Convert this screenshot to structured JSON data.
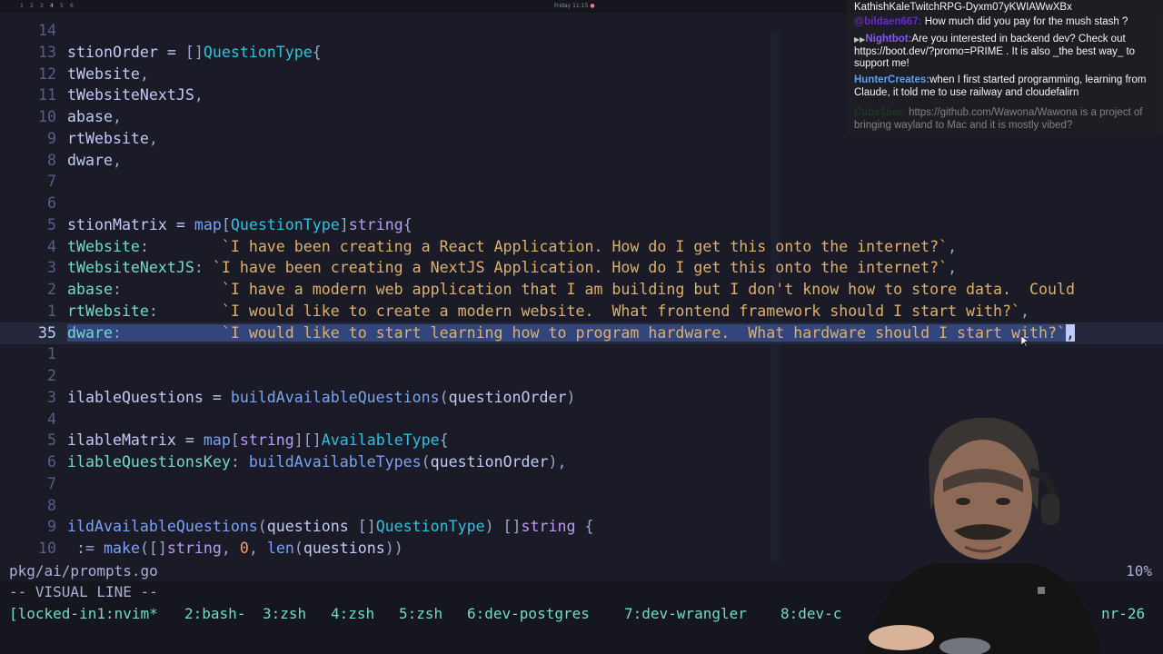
{
  "topbar": {
    "workspaces": [
      "1",
      "2",
      "3",
      "4",
      "5",
      "6"
    ],
    "active_workspace": "4",
    "clock": "Friday 11:15",
    "clock_indicator": "●"
  },
  "editor": {
    "lines": [
      {
        "ln": "14",
        "tokens": []
      },
      {
        "ln": "13",
        "tokens": [
          [
            "t-ident",
            "stionOrder = "
          ],
          [
            "t-punc",
            "[]"
          ],
          [
            "t-type",
            "QuestionType"
          ],
          [
            "t-punc",
            "{"
          ]
        ]
      },
      {
        "ln": "12",
        "tokens": [
          [
            "t-ident",
            "tWebsite"
          ],
          [
            "t-punc",
            ","
          ]
        ]
      },
      {
        "ln": "11",
        "tokens": [
          [
            "t-ident",
            "tWebsiteNextJS"
          ],
          [
            "t-punc",
            ","
          ]
        ]
      },
      {
        "ln": "10",
        "tokens": [
          [
            "t-ident",
            "abase"
          ],
          [
            "t-punc",
            ","
          ]
        ]
      },
      {
        "ln": "9",
        "tokens": [
          [
            "t-ident",
            "rtWebsite"
          ],
          [
            "t-punc",
            ","
          ]
        ]
      },
      {
        "ln": "8",
        "tokens": [
          [
            "t-ident",
            "dware"
          ],
          [
            "t-punc",
            ","
          ]
        ]
      },
      {
        "ln": "7",
        "tokens": []
      },
      {
        "ln": "6",
        "tokens": []
      },
      {
        "ln": "5",
        "tokens": [
          [
            "t-ident",
            "stionMatrix = "
          ],
          [
            "t-call",
            "map"
          ],
          [
            "t-punc",
            "["
          ],
          [
            "t-type",
            "QuestionType"
          ],
          [
            "t-punc",
            "]"
          ],
          [
            "t-kw",
            "string"
          ],
          [
            "t-punc",
            "{"
          ]
        ]
      },
      {
        "ln": "4",
        "tokens": [
          [
            "t-field",
            "tWebsite"
          ],
          [
            "t-punc",
            ":        "
          ],
          [
            "t-str",
            "`I have been creating a React Application. How do I get this onto the internet?`"
          ],
          [
            "t-punc",
            ","
          ]
        ]
      },
      {
        "ln": "3",
        "tokens": [
          [
            "t-field",
            "tWebsiteNextJS"
          ],
          [
            "t-punc",
            ": "
          ],
          [
            "t-str",
            "`I have been creating a NextJS Application. How do I get this onto the internet?`"
          ],
          [
            "t-punc",
            ","
          ]
        ]
      },
      {
        "ln": "2",
        "tokens": [
          [
            "t-field",
            "abase"
          ],
          [
            "t-punc",
            ":           "
          ],
          [
            "t-str",
            "`I have a modern web application that I am building but I don't know how to store data.  Could"
          ]
        ]
      },
      {
        "ln": "1",
        "tokens": [
          [
            "t-field",
            "rtWebsite"
          ],
          [
            "t-punc",
            ":       "
          ],
          [
            "t-str",
            "`I would like to create a modern website.  What frontend framework should I start with?`"
          ],
          [
            "t-punc",
            ","
          ]
        ]
      },
      {
        "ln": "35",
        "current": true,
        "tokens": [
          [
            "t-field hl",
            "dware"
          ],
          [
            "t-punc hl",
            ":           "
          ],
          [
            "t-str hl",
            "`I would like to start learning how to program hardware.  What hardware should I start with?`"
          ],
          [
            "cursor-block",
            ","
          ]
        ]
      },
      {
        "ln": "1",
        "tokens": []
      },
      {
        "ln": "2",
        "tokens": []
      },
      {
        "ln": "3",
        "tokens": [
          [
            "t-ident",
            "ilableQuestions = "
          ],
          [
            "t-call",
            "buildAvailableQuestions"
          ],
          [
            "t-punc",
            "("
          ],
          [
            "t-ident",
            "questionOrder"
          ],
          [
            "t-punc",
            ")"
          ]
        ]
      },
      {
        "ln": "4",
        "tokens": []
      },
      {
        "ln": "5",
        "tokens": [
          [
            "t-ident",
            "ilableMatrix = "
          ],
          [
            "t-call",
            "map"
          ],
          [
            "t-punc",
            "["
          ],
          [
            "t-kw",
            "string"
          ],
          [
            "t-punc",
            "][]"
          ],
          [
            "t-type",
            "AvailableType"
          ],
          [
            "t-punc",
            "{"
          ]
        ]
      },
      {
        "ln": "6",
        "tokens": [
          [
            "t-field",
            "ilableQuestionsKey"
          ],
          [
            "t-punc",
            ": "
          ],
          [
            "t-call",
            "buildAvailableTypes"
          ],
          [
            "t-punc",
            "("
          ],
          [
            "t-ident",
            "questionOrder"
          ],
          [
            "t-punc",
            "),"
          ]
        ]
      },
      {
        "ln": "7",
        "tokens": []
      },
      {
        "ln": "8",
        "tokens": []
      },
      {
        "ln": "9",
        "tokens": [
          [
            "t-call",
            "ildAvailableQuestions"
          ],
          [
            "t-punc",
            "("
          ],
          [
            "t-ident",
            "questions "
          ],
          [
            "t-punc",
            "[]"
          ],
          [
            "t-type",
            "QuestionType"
          ],
          [
            "t-punc",
            ") []"
          ],
          [
            "t-kw",
            "string"
          ],
          [
            "t-punc",
            " {"
          ]
        ]
      },
      {
        "ln": "10",
        "tokens": [
          [
            "t-punc",
            " := "
          ],
          [
            "t-call",
            "make"
          ],
          [
            "t-punc",
            "([]"
          ],
          [
            "t-kw",
            "string"
          ],
          [
            "t-punc",
            ", "
          ],
          [
            "t-num",
            "0"
          ],
          [
            "t-punc",
            ", "
          ],
          [
            "t-call",
            "len"
          ],
          [
            "t-punc",
            "("
          ],
          [
            "t-ident",
            "questions"
          ],
          [
            "t-punc",
            "))"
          ]
        ]
      }
    ]
  },
  "statusline": {
    "filename": "pkg/ai/prompts.go",
    "scroll": "10%"
  },
  "cmdline": {
    "mode": "-- VISUAL LINE --"
  },
  "tmux": {
    "tabs": [
      {
        "label": "[locked-in1:nvim*"
      },
      {
        "label": "2:bash-"
      },
      {
        "label": "3:zsh"
      },
      {
        "label": "4:zsh"
      },
      {
        "label": "5:zsh"
      },
      {
        "label": "6:dev-postgres"
      },
      {
        "label": "7:dev-wrangler"
      },
      {
        "label": "8:dev-c"
      },
      {
        "label": "nr-26"
      }
    ]
  },
  "chat": {
    "messages": [
      {
        "user": "",
        "user_color": "#ffffff",
        "text": "KathishKaleTwitchRPG-Dyxm07yKWIAWwXBx"
      },
      {
        "user": "@bildaen667:",
        "user_color": "#6d28d9",
        "text": " How much did you pay for the mush stash ?"
      },
      {
        "user": "Nightbot:",
        "user_color": "#8a5cf6",
        "badge": "▶▶",
        "text": "Are you interested in backend dev? Check out https://boot.dev/?promo=PRIME . It is also _the best way_ to support me!"
      },
      {
        "user": "HunterCreates:",
        "user_color": "#5aa9ff",
        "text": "when I first started programming, learning from Claude, it told me to use railway and cloudefalirn"
      },
      {
        "user": "Cube1ber:",
        "user_color": "#1e5a2a",
        "text": " https://github.com/Wawona/Wawona is a project of bringing wayland to Mac and it is mostly vibed?",
        "dim": true
      }
    ]
  },
  "colors": {
    "background": "#1a1b26",
    "current_line": "#24283b",
    "selection": "#33467c",
    "string": "#e0af68",
    "type": "#2ac3de",
    "keyword": "#bb9af7",
    "function": "#7aa2f7",
    "field": "#73daca"
  }
}
